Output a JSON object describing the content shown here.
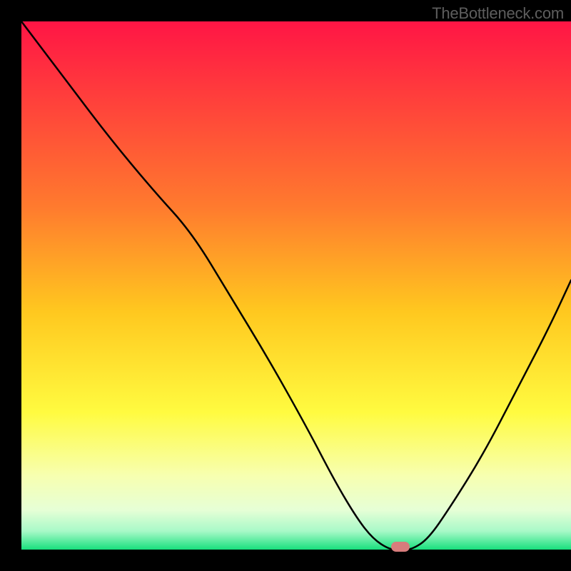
{
  "attribution": "TheBottleneck.com",
  "chart_data": {
    "type": "line",
    "title": "",
    "xlabel": "",
    "ylabel": "",
    "xlim": [
      0,
      100
    ],
    "ylim": [
      0,
      100
    ],
    "grid": false,
    "legend": false,
    "gradient_stops": [
      {
        "offset": 0,
        "color": "#ff1545"
      },
      {
        "offset": 0.35,
        "color": "#ff7a2e"
      },
      {
        "offset": 0.55,
        "color": "#ffc81f"
      },
      {
        "offset": 0.74,
        "color": "#fffb40"
      },
      {
        "offset": 0.86,
        "color": "#f7ffb0"
      },
      {
        "offset": 0.925,
        "color": "#e6ffd6"
      },
      {
        "offset": 0.965,
        "color": "#a8f9c8"
      },
      {
        "offset": 1.0,
        "color": "#18e07d"
      }
    ],
    "series": [
      {
        "name": "bottleneck-curve",
        "x": [
          0,
          8,
          16,
          24,
          31,
          38,
          45,
          52,
          57,
          61,
          64,
          67,
          69,
          71,
          74,
          78,
          84,
          90,
          96,
          100
        ],
        "y": [
          100,
          89,
          78,
          68,
          60,
          48,
          36,
          23,
          13,
          6,
          2,
          0,
          0,
          0,
          2,
          8,
          18,
          30,
          42,
          51
        ]
      }
    ],
    "marker": {
      "x": 69,
      "y": 0.6,
      "color": "#d77c7c"
    }
  }
}
